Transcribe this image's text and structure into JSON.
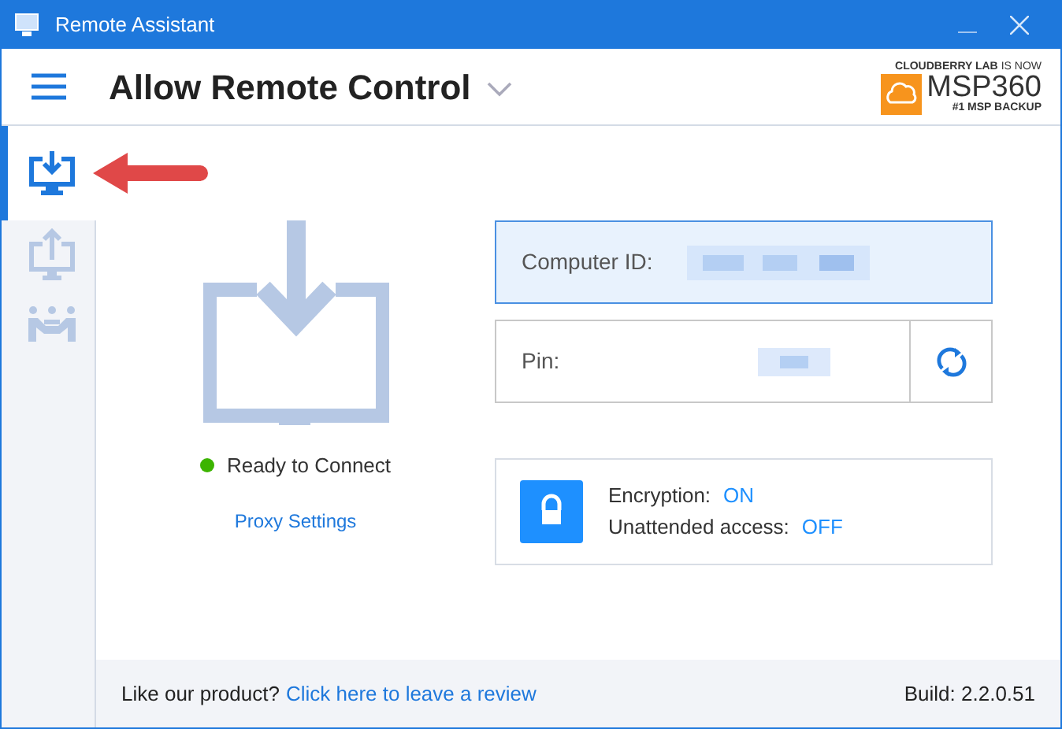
{
  "window": {
    "title": "Remote Assistant"
  },
  "header": {
    "title": "Allow Remote Control",
    "logo": {
      "tagline_top": "CLOUDBERRY LAB",
      "tagline_top_light": "IS NOW",
      "brand": "MSP360",
      "tagline_bottom": "#1 MSP BACKUP"
    }
  },
  "sidebar": {
    "items": [
      {
        "kind": "receive",
        "selected": true
      },
      {
        "kind": "share",
        "selected": false
      },
      {
        "kind": "meeting",
        "selected": false
      }
    ]
  },
  "status": {
    "text": "Ready to Connect",
    "color": "#3cb400"
  },
  "proxy_link": "Proxy Settings",
  "computer_id": {
    "label": "Computer ID:"
  },
  "pin": {
    "label": "Pin:"
  },
  "security": {
    "rows": [
      {
        "label": "Encryption:",
        "value": "ON"
      },
      {
        "label": "Unattended access:",
        "value": "OFF"
      }
    ]
  },
  "footer": {
    "prompt": "Like our product?",
    "link": "Click here to leave a review",
    "build": "Build: 2.2.0.51"
  }
}
